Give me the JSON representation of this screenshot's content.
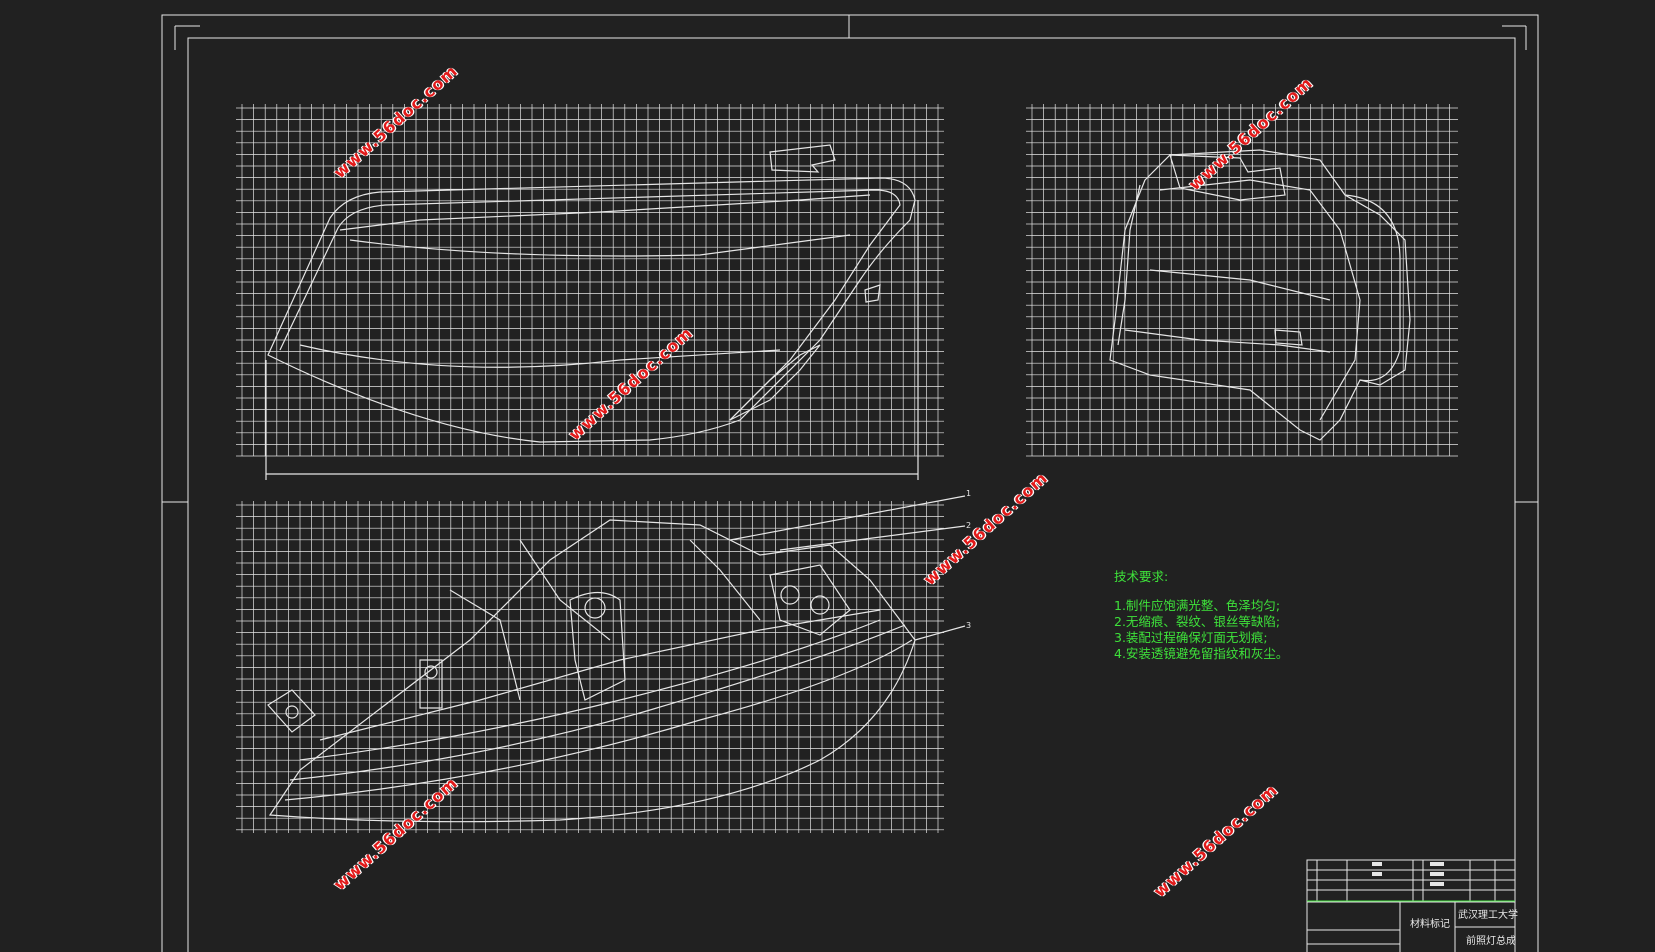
{
  "drawing": {
    "background": "#212121",
    "line_color": "#e6e6e6",
    "accent_color": "#3ee23a",
    "watermark_color": "#e21a1a"
  },
  "tech_requirements": {
    "title": "技术要求:",
    "items": [
      "1.制件应饱满光整、色泽均匀;",
      "2.无缩痕、裂纹、银丝等缺陷;",
      "3.装配过程确保灯面无划痕;",
      "4.安装透镜避免留指纹和灰尘。"
    ]
  },
  "watermarks": [
    "www.56doc.com",
    "www.56doc.com",
    "www.56doc.com",
    "www.56doc.com",
    "www.56doc.com",
    "www.56doc.com"
  ],
  "title_block": {
    "school": "武汉理工大学",
    "drawing_name": "前照灯总成",
    "material_label": "材料标记"
  },
  "leader_labels": [
    "1",
    "2",
    "3"
  ]
}
